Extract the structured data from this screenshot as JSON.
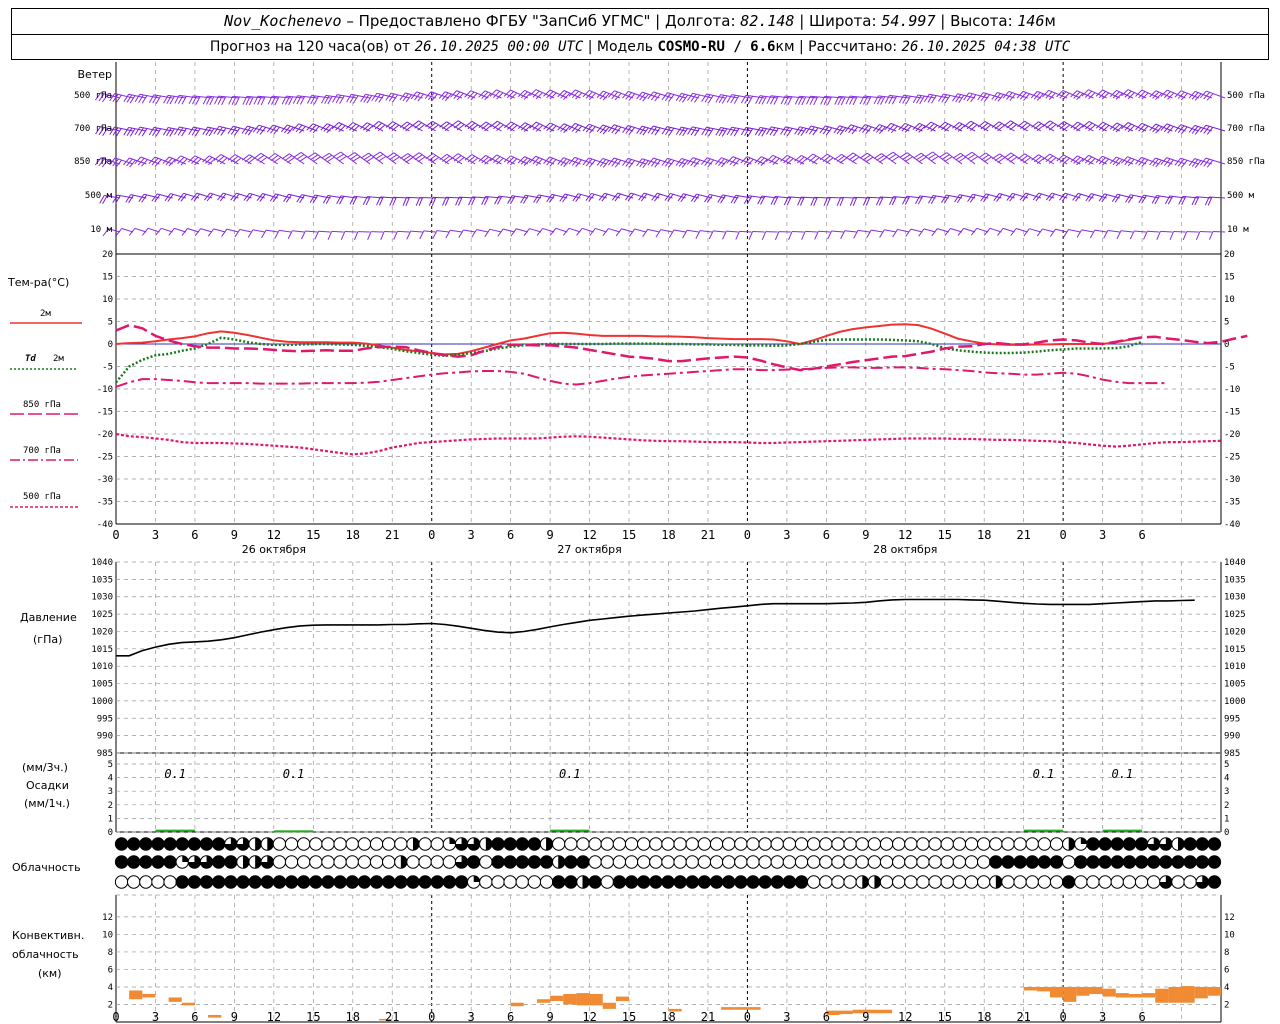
{
  "header": {
    "station": "Nov_Kochenevo",
    "provided_by": " – Предоставлено ФГБУ \"ЗапСиб УГМС\" | Долгота: ",
    "lon": "82.148",
    "lat_label": " | Широта: ",
    "lat": "54.997",
    "alt_label": " | Высота: ",
    "alt": "146",
    "alt_unit": "м",
    "forecast_label": "Прогноз на 120 часа(ов) от ",
    "forecast_from": "26.10.2025 00:00 UTC",
    "model_label": "  | Модель ",
    "model": "COSMO-RU / 6.6",
    "model_unit": "км",
    "calc_label": " | Рассчитано: ",
    "calc_time": "26.10.2025 04:38 UTC"
  },
  "labels": {
    "wind": "Ветер",
    "wind_levels": [
      "500 гПа",
      "700 гПа",
      "850 гПа",
      "500 м",
      "10  м"
    ],
    "temp": "Тем-ра(°С)",
    "t2m": "2м",
    "td_a": "Td",
    "td_b": "2м",
    "t850": "850 гПа",
    "t700": "700 гПа",
    "t500": "500 гПа",
    "pressure": "Давление",
    "pressure_unit": "(гПа)",
    "precip_a": "(мм/3ч.)",
    "precip_b": "Осадки",
    "precip_c": "(мм/1ч.)",
    "cloud": "Облачность",
    "conv_a": "Конвективн.",
    "conv_b": "облачность",
    "conv_c": "(км)"
  },
  "chart_data": [
    {
      "type": "line",
      "name": "temperature",
      "x_hours": [
        0,
        1,
        2,
        3,
        4,
        5,
        6,
        7,
        8,
        9,
        10,
        11,
        12,
        13,
        14,
        15,
        16,
        17,
        18,
        19,
        20,
        21,
        22,
        23,
        24,
        25,
        26,
        27,
        28,
        29,
        30,
        31,
        32,
        33,
        34,
        35,
        36,
        37,
        38,
        39,
        40,
        41,
        42,
        43,
        44,
        45,
        46,
        47,
        48,
        49,
        50,
        51,
        52,
        53,
        54,
        55,
        56,
        57,
        58,
        59,
        60,
        61,
        62,
        63,
        64,
        65,
        66,
        67,
        68,
        69,
        70,
        71,
        72,
        73,
        74,
        75,
        76,
        77,
        78
      ],
      "x_ticks": [
        0,
        3,
        6,
        9,
        12,
        15,
        18,
        21,
        0,
        3,
        6,
        9,
        12,
        15,
        18,
        21,
        0,
        3,
        6,
        9,
        12,
        15,
        18,
        21,
        0,
        3,
        6
      ],
      "days": [
        "26 октября",
        "27 октября",
        "28 октября"
      ],
      "ylim": [
        -40,
        20
      ],
      "yticks": [
        20,
        15,
        10,
        5,
        0,
        -5,
        -10,
        -15,
        -20,
        -25,
        -30,
        -35,
        -40
      ],
      "series": [
        {
          "name": "2м",
          "color": "#f03232",
          "style": "solid",
          "values": [
            0,
            0.2,
            0.3,
            0.6,
            1,
            1.3,
            1.7,
            2.4,
            2.8,
            2.5,
            2,
            1.4,
            0.8,
            0.5,
            0.4,
            0.4,
            0.4,
            0.3,
            0.3,
            0.1,
            -0.3,
            -0.8,
            -1.3,
            -1.6,
            -2,
            -2.3,
            -2.2,
            -1.6,
            -0.8,
            0,
            0.8,
            1.2,
            1.8,
            2.4,
            2.5,
            2.3,
            2,
            1.8,
            1.8,
            1.8,
            1.8,
            1.7,
            1.7,
            1.6,
            1.5,
            1.3,
            1.2,
            1.1,
            1.1,
            1.1,
            1,
            0.6,
            0,
            0.8,
            1.8,
            2.7,
            3.3,
            3.7,
            4,
            4.3,
            4.4,
            4.2,
            3.4,
            2.3,
            1.2,
            0.6,
            0.1,
            -0.1,
            -0.2,
            -0.2,
            -0.1,
            -0.1,
            0,
            0,
            0,
            0,
            0.4,
            0.9,
            1.5
          ]
        },
        {
          "name": "Td 2м",
          "color": "#1a7a1a",
          "style": "dotted",
          "values": [
            -8.5,
            -5,
            -3.5,
            -2.5,
            -2.2,
            -1.5,
            -1,
            0,
            1.4,
            1,
            0.4,
            0,
            -0.2,
            -0.2,
            -0.1,
            0,
            0,
            -0.1,
            -0.2,
            -0.4,
            -0.7,
            -1.1,
            -1.6,
            -2,
            -2.4,
            -2.6,
            -2.4,
            -2,
            -1.6,
            -1,
            -0.6,
            -0.3,
            -0.1,
            0,
            0,
            0,
            0,
            0,
            0.1,
            0.1,
            0.1,
            0.1,
            0,
            0,
            -0.1,
            -0.1,
            -0.2,
            -0.2,
            -0.3,
            -0.3,
            -0.4,
            -0.3,
            0,
            0.5,
            0.9,
            1,
            1,
            1,
            1,
            0.9,
            0.8,
            0.6,
            0,
            -0.9,
            -1.4,
            -1.7,
            -1.9,
            -2,
            -2,
            -1.9,
            -1.7,
            -1.4,
            -1.2,
            -1,
            -1,
            -1,
            -0.9,
            -0.5,
            0.5
          ]
        },
        {
          "name": "850 гПа",
          "color": "#e0186c",
          "style": "dash",
          "values": [
            3,
            4.2,
            3.5,
            1.8,
            0.8,
            0,
            -0.5,
            -0.8,
            -0.8,
            -1,
            -1,
            -1.1,
            -1.3,
            -1.5,
            -1.6,
            -1.5,
            -1.4,
            -1.5,
            -1.5,
            -1,
            -0.7,
            -0.6,
            -0.7,
            -1.4,
            -2,
            -2.5,
            -2.8,
            -2.5,
            -1.5,
            -0.7,
            -0.2,
            -0.2,
            -0.3,
            -0.3,
            -0.5,
            -0.8,
            -1.3,
            -1.8,
            -2.3,
            -2.8,
            -3,
            -3.3,
            -3.8,
            -3.8,
            -3.5,
            -3.2,
            -3,
            -2.8,
            -3,
            -3.7,
            -4.5,
            -5.2,
            -5.8,
            -5.5,
            -5,
            -4.5,
            -4,
            -3.6,
            -3.2,
            -2.8,
            -2.7,
            -2.2,
            -1.7,
            -1,
            -0.6,
            -0.5,
            0,
            0.2,
            -0.1,
            -0.1,
            0.3,
            0.8,
            1,
            0.8,
            0.3,
            0,
            0.5,
            1,
            1.5,
            1.6,
            1.2,
            0.9,
            0.5,
            0.2,
            0.5,
            1.2,
            1.8
          ]
        },
        {
          "name": "700 гПа",
          "color": "#e0186c",
          "style": "dashdot",
          "values": [
            -9.5,
            -8.5,
            -7.8,
            -7.8,
            -8,
            -8.2,
            -8.5,
            -8.7,
            -8.7,
            -8.7,
            -8.7,
            -8.8,
            -8.8,
            -8.8,
            -8.8,
            -8.7,
            -8.7,
            -8.7,
            -8.7,
            -8.6,
            -8.4,
            -8,
            -7.6,
            -7.2,
            -6.8,
            -6.5,
            -6.3,
            -6.1,
            -6,
            -6,
            -6.2,
            -6.6,
            -7.4,
            -8.2,
            -8.8,
            -9,
            -8.7,
            -8.2,
            -7.7,
            -7.3,
            -7,
            -6.8,
            -6.6,
            -6.4,
            -6.2,
            -6,
            -5.8,
            -5.6,
            -5.6,
            -5.8,
            -5.8,
            -5.7,
            -5.6,
            -5.5,
            -5.3,
            -5.2,
            -5.2,
            -5.3,
            -5.3,
            -5.2,
            -5.2,
            -5.3,
            -5.5,
            -5.6,
            -5.8,
            -6,
            -6.3,
            -6.5,
            -6.6,
            -6.8,
            -6.8,
            -6.6,
            -6.4,
            -6.6,
            -7.2,
            -7.9,
            -8.4,
            -8.7,
            -8.7,
            -8.7,
            -8.7
          ]
        },
        {
          "name": "500 гПа",
          "color": "#e0186c",
          "style": "dot",
          "values": [
            -20,
            -20.5,
            -20.7,
            -21,
            -21.3,
            -21.8,
            -22,
            -22,
            -22,
            -22.1,
            -22.2,
            -22.4,
            -22.6,
            -22.8,
            -23,
            -23.4,
            -23.8,
            -24.2,
            -24.5,
            -24.3,
            -23.8,
            -23,
            -22.5,
            -22,
            -21.8,
            -21.6,
            -21.4,
            -21.2,
            -21.1,
            -21,
            -21,
            -21,
            -21,
            -20.8,
            -20.6,
            -20.5,
            -20.6,
            -20.8,
            -21,
            -21.2,
            -21.4,
            -21.5,
            -21.6,
            -21.6,
            -21.7,
            -21.8,
            -21.8,
            -21.8,
            -21.9,
            -22,
            -22,
            -21.9,
            -21.8,
            -21.7,
            -21.6,
            -21.5,
            -21.4,
            -21.3,
            -21.2,
            -21.1,
            -21,
            -21,
            -21,
            -21,
            -21.1,
            -21.1,
            -21.2,
            -21.3,
            -21.3,
            -21.4,
            -21.5,
            -21.6,
            -21.8,
            -22,
            -22.3,
            -22.6,
            -22.8,
            -22.6,
            -22.3,
            -22,
            -21.8,
            -21.8,
            -21.7,
            -21.6,
            -21.5
          ]
        }
      ]
    },
    {
      "type": "line",
      "name": "pressure",
      "ylabel": "Давление (гПа)",
      "ylim": [
        985,
        1040
      ],
      "yticks": [
        1040,
        1035,
        1030,
        1025,
        1020,
        1015,
        1010,
        1005,
        1000,
        995,
        990,
        985
      ],
      "values": [
        1013,
        1013,
        1014.5,
        1015.5,
        1016.3,
        1016.8,
        1017,
        1017.2,
        1017.6,
        1018.2,
        1019,
        1019.8,
        1020.5,
        1021.1,
        1021.6,
        1021.8,
        1021.9,
        1021.9,
        1021.9,
        1021.9,
        1021.9,
        1022,
        1022,
        1022.2,
        1022.3,
        1022,
        1021.5,
        1020.9,
        1020.3,
        1019.8,
        1019.6,
        1020,
        1020.6,
        1021.3,
        1022,
        1022.6,
        1023.2,
        1023.6,
        1024,
        1024.4,
        1024.7,
        1025,
        1025.3,
        1025.6,
        1025.9,
        1026.3,
        1026.7,
        1027,
        1027.4,
        1027.8,
        1028,
        1028,
        1028,
        1028,
        1028,
        1028.1,
        1028.2,
        1028.4,
        1028.8,
        1029.1,
        1029.2,
        1029.2,
        1029.2,
        1029.2,
        1029.2,
        1029.1,
        1029,
        1028.7,
        1028.4,
        1028.1,
        1027.9,
        1027.8,
        1027.8,
        1027.8,
        1027.8,
        1028,
        1028.2,
        1028.4,
        1028.6,
        1028.8,
        1028.8,
        1028.9,
        1029
      ]
    },
    {
      "type": "bar",
      "name": "precipitation",
      "ylim": [
        0,
        5
      ],
      "yticks": [
        5,
        4,
        3,
        2,
        1,
        0
      ],
      "labels": [
        {
          "x": 4.5,
          "text": "0.1"
        },
        {
          "x": 13.5,
          "text": "0.1"
        },
        {
          "x": 34.5,
          "text": "0.1"
        },
        {
          "x": 70.5,
          "text": "0.1"
        },
        {
          "x": 76.5,
          "text": "0.1"
        }
      ],
      "bars": [
        {
          "x": 4.5,
          "v": 0.1
        },
        {
          "x": 13.5,
          "v": 0.05
        },
        {
          "x": 34.5,
          "v": 0.1
        },
        {
          "x": 70.5,
          "v": 0.1
        },
        {
          "x": 76.5,
          "v": 0.1
        }
      ]
    },
    {
      "type": "table",
      "name": "cloudiness",
      "rows": [
        "8888888886655000000000005004665888870000000000000000000000000000000000000000005488888665888",
        "8888846688556000000000050000680888887880000000000000000000000000000000008888880888888888888",
        "0000088888888888888888888888840000008878088888888888888880000550000000005000008000000060068"
      ]
    },
    {
      "type": "bar",
      "name": "convective",
      "ylim": [
        0,
        14
      ],
      "yticks": [
        12,
        10,
        8,
        6,
        4,
        2,
        0
      ],
      "boxes": [
        {
          "x": 1.5,
          "lo": 2.6,
          "hi": 3.6
        },
        {
          "x": 2.5,
          "lo": 2.8,
          "hi": 3.2
        },
        {
          "x": 4.5,
          "lo": 2.3,
          "hi": 2.8
        },
        {
          "x": 5.5,
          "lo": 1.9,
          "hi": 2.2
        },
        {
          "x": 7.5,
          "lo": 0.5,
          "hi": 0.8
        },
        {
          "x": 20.5,
          "lo": 0.2,
          "hi": 0.35
        },
        {
          "x": 30.5,
          "lo": 1.8,
          "hi": 2.2
        },
        {
          "x": 32.5,
          "lo": 2.2,
          "hi": 2.6
        },
        {
          "x": 33.5,
          "lo": 2.4,
          "hi": 3.0
        },
        {
          "x": 34.5,
          "lo": 2.0,
          "hi": 3.2
        },
        {
          "x": 35.5,
          "lo": 1.9,
          "hi": 3.3
        },
        {
          "x": 36.5,
          "lo": 1.9,
          "hi": 3.2
        },
        {
          "x": 37.5,
          "lo": 1.5,
          "hi": 2.2
        },
        {
          "x": 38.5,
          "lo": 2.4,
          "hi": 2.9
        },
        {
          "x": 42.5,
          "lo": 1.2,
          "hi": 1.5
        },
        {
          "x": 46.5,
          "lo": 1.4,
          "hi": 1.7
        },
        {
          "x": 47.5,
          "lo": 1.4,
          "hi": 1.7
        },
        {
          "x": 48.5,
          "lo": 1.4,
          "hi": 1.7
        },
        {
          "x": 54.5,
          "lo": 0.8,
          "hi": 1.3
        },
        {
          "x": 55.5,
          "lo": 0.9,
          "hi": 1.3
        },
        {
          "x": 56.5,
          "lo": 1.0,
          "hi": 1.4
        },
        {
          "x": 57.5,
          "lo": 1.0,
          "hi": 1.4
        },
        {
          "x": 58.5,
          "lo": 1.0,
          "hi": 1.4
        },
        {
          "x": 69.5,
          "lo": 3.6,
          "hi": 4.0
        },
        {
          "x": 70.5,
          "lo": 3.5,
          "hi": 4.0
        },
        {
          "x": 71.5,
          "lo": 2.8,
          "hi": 4.0
        },
        {
          "x": 72.5,
          "lo": 2.3,
          "hi": 4.0
        },
        {
          "x": 73.5,
          "lo": 3.0,
          "hi": 4.0
        },
        {
          "x": 74.5,
          "lo": 3.2,
          "hi": 4.0
        },
        {
          "x": 75.5,
          "lo": 2.9,
          "hi": 3.8
        },
        {
          "x": 76.5,
          "lo": 2.8,
          "hi": 3.3
        },
        {
          "x": 77.5,
          "lo": 2.8,
          "hi": 3.2
        },
        {
          "x": 78.5,
          "lo": 2.8,
          "hi": 3.3
        },
        {
          "x": 79.5,
          "lo": 2.2,
          "hi": 3.8
        },
        {
          "x": 80.5,
          "lo": 2.2,
          "hi": 4.0
        },
        {
          "x": 81.5,
          "lo": 2.2,
          "hi": 4.1
        },
        {
          "x": 82.5,
          "lo": 2.7,
          "hi": 4.0
        },
        {
          "x": 83.5,
          "lo": 3.0,
          "hi": 4.0
        }
      ]
    }
  ],
  "colors": {
    "wind": "#8a2be2",
    "wind2": "#7b1fd6",
    "grid": "#999999",
    "convective": "#f08a33",
    "precip": "#22aa22"
  }
}
